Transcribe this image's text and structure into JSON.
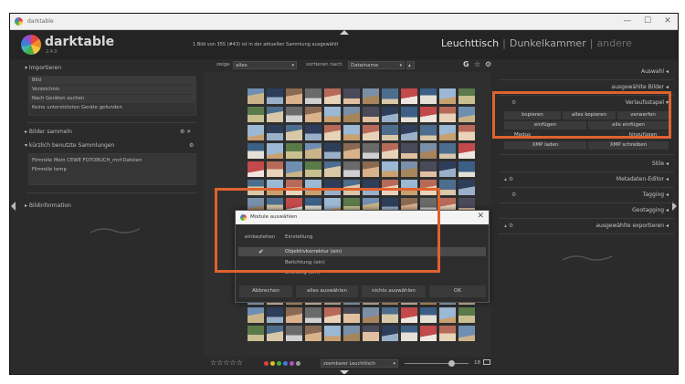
{
  "window": {
    "title": "darktable",
    "controls": {
      "minimize": "—",
      "maximize": "☐",
      "close": "✕"
    }
  },
  "header": {
    "brand": "darktable",
    "version": "2.4.0",
    "collection_count": "1 Bild von 355 (#43) ist in der aktuellen Sammlung ausgewählt",
    "views": {
      "lighttable": "Leuchttisch",
      "darkroom": "Dunkelkammer",
      "other": "andere"
    }
  },
  "left_panel": {
    "import": {
      "title": "Importieren",
      "items": [
        "Bild",
        "Verzeichnis",
        "Nach Geräten suchen",
        "Keine unterstützten Geräte gefunden"
      ]
    },
    "collect": {
      "title": "Bilder sammeln",
      "controls": "⚙ ✕"
    },
    "recent": {
      "title": "kürzlich benutzte Sammlungen",
      "control": "⚙",
      "items": [
        "Filmrolle Mein CEWE FOTOBUCH_mcf-Dateien",
        "Filmrolle temp"
      ]
    },
    "info": {
      "title": "Bildinformation"
    }
  },
  "toolbar": {
    "show_label": "zeige",
    "show_value": "alles",
    "sort_label": "sortieren nach",
    "sort_value": "Dateiname",
    "sort_dir": "▴",
    "icons": {
      "grouping": "G",
      "star": "☆",
      "gear": "⚙"
    }
  },
  "right_panel": {
    "select": {
      "title": "Auswahl"
    },
    "selected_images": {
      "title": "ausgewählte Bilder"
    },
    "history_stack": {
      "title": "Verlaufsstapel",
      "control": "⚙",
      "buttons": {
        "copy": "kopieren",
        "copy_all": "alles kopieren",
        "discard": "verwerfen",
        "paste": "einfügen",
        "paste_all": "alle einfügen",
        "mode_left": "Modus",
        "mode_right": "hinzufügen",
        "load_xmp": "XMP laden",
        "write_xmp": "XMP schreiben"
      }
    },
    "styles": {
      "title": "Stile"
    },
    "metadata": {
      "title": "Metadaten-Editor",
      "control": "⚙"
    },
    "tagging": {
      "title": "Tagging",
      "control": "⚙"
    },
    "geotagging": {
      "title": "Geotagging"
    },
    "export": {
      "title": "ausgewählte exportieren",
      "control": "⚙"
    }
  },
  "dialog": {
    "title": "Module auswählen",
    "headers": {
      "include": "einbeziehen",
      "item": "Einstellung"
    },
    "rows": [
      {
        "checked": "✔",
        "label": "Objektivkorrektur (ein)"
      },
      {
        "checked": "",
        "label": "Belichtung (ein)"
      },
      {
        "checked": "",
        "label": "Drehung (ein)"
      }
    ],
    "buttons": {
      "cancel": "Abbrechen",
      "select_all": "alles auswählen",
      "select_none": "nichts auswählen",
      "ok": "OK"
    }
  },
  "bottom_bar": {
    "stars": "☆☆☆☆☆",
    "color_labels": [
      "#e04040",
      "#e0c020",
      "#40b040",
      "#3f7fd6",
      "#b050c0",
      "#9a9a9a"
    ],
    "layout_value": "zoombarer Leuchttisch",
    "zoom": "18"
  },
  "colors": {
    "highlight": "#e0622f",
    "background": "#2b2b2b"
  }
}
